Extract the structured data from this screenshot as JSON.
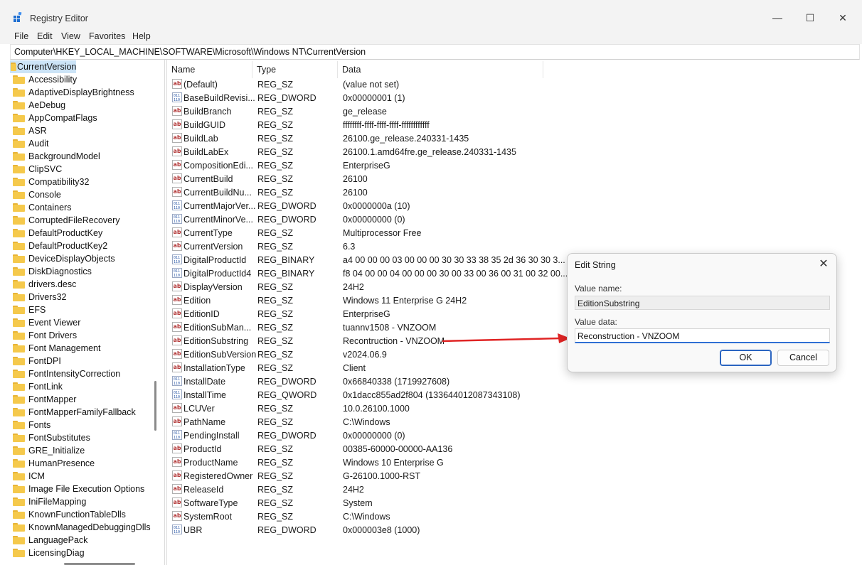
{
  "window": {
    "title": "Registry Editor",
    "minimize_glyph": "—",
    "maximize_glyph": "☐",
    "close_glyph": "✕"
  },
  "menu": [
    "File",
    "Edit",
    "View",
    "Favorites",
    "Help"
  ],
  "address": "Computer\\HKEY_LOCAL_MACHINE\\SOFTWARE\\Microsoft\\Windows NT\\CurrentVersion",
  "tree": {
    "items": [
      "CurrentVersion",
      "Accessibility",
      "AdaptiveDisplayBrightness",
      "AeDebug",
      "AppCompatFlags",
      "ASR",
      "Audit",
      "BackgroundModel",
      "ClipSVC",
      "Compatibility32",
      "Console",
      "Containers",
      "CorruptedFileRecovery",
      "DefaultProductKey",
      "DefaultProductKey2",
      "DeviceDisplayObjects",
      "DiskDiagnostics",
      "drivers.desc",
      "Drivers32",
      "EFS",
      "Event Viewer",
      "Font Drivers",
      "Font Management",
      "FontDPI",
      "FontIntensityCorrection",
      "FontLink",
      "FontMapper",
      "FontMapperFamilyFallback",
      "Fonts",
      "FontSubstitutes",
      "GRE_Initialize",
      "HumanPresence",
      "ICM",
      "Image File Execution Options",
      "IniFileMapping",
      "KnownFunctionTableDlls",
      "KnownManagedDebuggingDlls",
      "LanguagePack",
      "LicensingDiag"
    ]
  },
  "list": {
    "headers": {
      "name": "Name",
      "type": "Type",
      "data": "Data"
    },
    "rows": [
      {
        "icon": "string-value-icon",
        "name": "(Default)",
        "type": "REG_SZ",
        "data": "(value not set)"
      },
      {
        "icon": "binary-value-icon",
        "name": "BaseBuildRevisi...",
        "type": "REG_DWORD",
        "data": "0x00000001 (1)"
      },
      {
        "icon": "string-value-icon",
        "name": "BuildBranch",
        "type": "REG_SZ",
        "data": "ge_release"
      },
      {
        "icon": "string-value-icon",
        "name": "BuildGUID",
        "type": "REG_SZ",
        "data": "ffffffff-ffff-ffff-ffff-ffffffffffff"
      },
      {
        "icon": "string-value-icon",
        "name": "BuildLab",
        "type": "REG_SZ",
        "data": "26100.ge_release.240331-1435"
      },
      {
        "icon": "string-value-icon",
        "name": "BuildLabEx",
        "type": "REG_SZ",
        "data": "26100.1.amd64fre.ge_release.240331-1435"
      },
      {
        "icon": "string-value-icon",
        "name": "CompositionEdi...",
        "type": "REG_SZ",
        "data": "EnterpriseG"
      },
      {
        "icon": "string-value-icon",
        "name": "CurrentBuild",
        "type": "REG_SZ",
        "data": "26100"
      },
      {
        "icon": "string-value-icon",
        "name": "CurrentBuildNu...",
        "type": "REG_SZ",
        "data": "26100"
      },
      {
        "icon": "binary-value-icon",
        "name": "CurrentMajorVer...",
        "type": "REG_DWORD",
        "data": "0x0000000a (10)"
      },
      {
        "icon": "binary-value-icon",
        "name": "CurrentMinorVe...",
        "type": "REG_DWORD",
        "data": "0x00000000 (0)"
      },
      {
        "icon": "string-value-icon",
        "name": "CurrentType",
        "type": "REG_SZ",
        "data": "Multiprocessor Free"
      },
      {
        "icon": "string-value-icon",
        "name": "CurrentVersion",
        "type": "REG_SZ",
        "data": "6.3"
      },
      {
        "icon": "binary-value-icon",
        "name": "DigitalProductId",
        "type": "REG_BINARY",
        "data": "a4 00 00 00 03 00 00 00 30 30 33 38 35 2d 36 30 30 3..."
      },
      {
        "icon": "binary-value-icon",
        "name": "DigitalProductId4",
        "type": "REG_BINARY",
        "data": "f8 04 00 00 04 00 00 00 30 00 33 00 36 00 31 00 32 00..."
      },
      {
        "icon": "string-value-icon",
        "name": "DisplayVersion",
        "type": "REG_SZ",
        "data": "24H2"
      },
      {
        "icon": "string-value-icon",
        "name": "Edition",
        "type": "REG_SZ",
        "data": "Windows 11 Enterprise G 24H2"
      },
      {
        "icon": "string-value-icon",
        "name": "EditionID",
        "type": "REG_SZ",
        "data": "EnterpriseG"
      },
      {
        "icon": "string-value-icon",
        "name": "EditionSubMan...",
        "type": "REG_SZ",
        "data": "tuannv1508 - VNZOOM"
      },
      {
        "icon": "string-value-icon",
        "name": "EditionSubstring",
        "type": "REG_SZ",
        "data": "Recontruction - VNZOOM"
      },
      {
        "icon": "string-value-icon",
        "name": "EditionSubVersion",
        "type": "REG_SZ",
        "data": "v2024.06.9"
      },
      {
        "icon": "string-value-icon",
        "name": "InstallationType",
        "type": "REG_SZ",
        "data": "Client"
      },
      {
        "icon": "binary-value-icon",
        "name": "InstallDate",
        "type": "REG_DWORD",
        "data": "0x66840338 (1719927608)"
      },
      {
        "icon": "binary-value-icon",
        "name": "InstallTime",
        "type": "REG_QWORD",
        "data": "0x1dacc855ad2f804 (133644012087343108)"
      },
      {
        "icon": "string-value-icon",
        "name": "LCUVer",
        "type": "REG_SZ",
        "data": "10.0.26100.1000"
      },
      {
        "icon": "string-value-icon",
        "name": "PathName",
        "type": "REG_SZ",
        "data": "C:\\Windows"
      },
      {
        "icon": "binary-value-icon",
        "name": "PendingInstall",
        "type": "REG_DWORD",
        "data": "0x00000000 (0)"
      },
      {
        "icon": "string-value-icon",
        "name": "ProductId",
        "type": "REG_SZ",
        "data": "00385-60000-00000-AA136"
      },
      {
        "icon": "string-value-icon",
        "name": "ProductName",
        "type": "REG_SZ",
        "data": "Windows 10 Enterprise G"
      },
      {
        "icon": "string-value-icon",
        "name": "RegisteredOwner",
        "type": "REG_SZ",
        "data": "G-26100.1000-RST"
      },
      {
        "icon": "string-value-icon",
        "name": "ReleaseId",
        "type": "REG_SZ",
        "data": "24H2"
      },
      {
        "icon": "string-value-icon",
        "name": "SoftwareType",
        "type": "REG_SZ",
        "data": "System"
      },
      {
        "icon": "string-value-icon",
        "name": "SystemRoot",
        "type": "REG_SZ",
        "data": "C:\\Windows"
      },
      {
        "icon": "binary-value-icon",
        "name": "UBR",
        "type": "REG_DWORD",
        "data": "0x000003e8 (1000)"
      }
    ]
  },
  "dialog": {
    "title": "Edit String",
    "value_name_label": "Value name:",
    "value_name": "EditionSubstring",
    "value_data_label": "Value data:",
    "value_data": "Reconstruction - VNZOOM",
    "ok_label": "OK",
    "cancel_label": "Cancel",
    "close_glyph": "✕"
  },
  "icons": {
    "string_glyph": "ab",
    "binary_glyph": "011\n110"
  },
  "colors": {
    "arrow": "#e02424",
    "selection": "#cce4f7",
    "accent": "#2f6fd4"
  }
}
